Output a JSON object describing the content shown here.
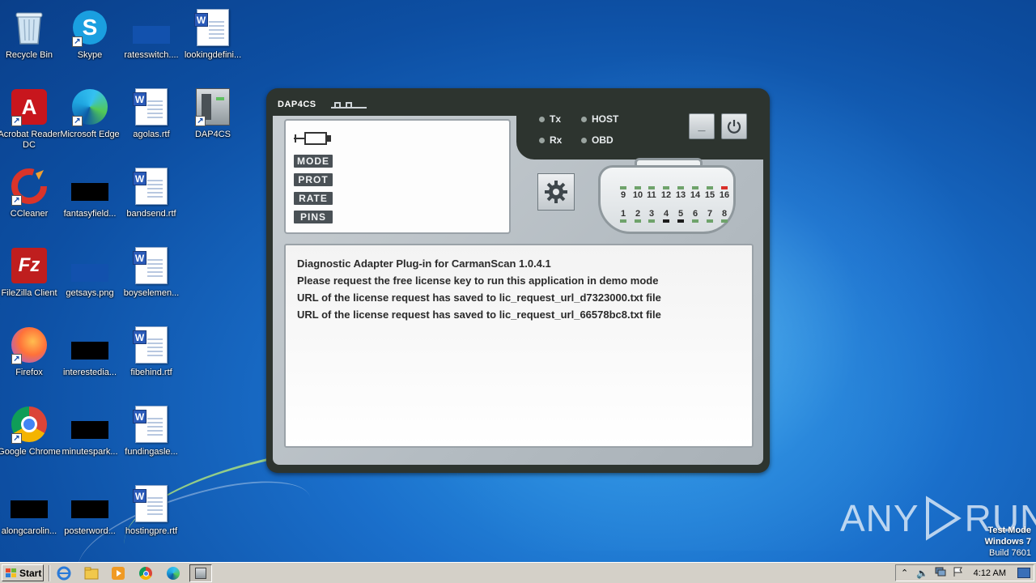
{
  "desktop": {
    "icons": [
      {
        "label": "Recycle Bin"
      },
      {
        "label": "Skype"
      },
      {
        "label": "ratesswitch...."
      },
      {
        "label": "lookingdefini..."
      },
      {
        "label": "Acrobat Reader DC"
      },
      {
        "label": "Microsoft Edge"
      },
      {
        "label": "agolas.rtf"
      },
      {
        "label": "DAP4CS"
      },
      {
        "label": "CCleaner"
      },
      {
        "label": "fantasyfield..."
      },
      {
        "label": "bandsend.rtf"
      },
      {
        "label": "FileZilla Client"
      },
      {
        "label": "getsays.png"
      },
      {
        "label": "boyselemen..."
      },
      {
        "label": "Firefox"
      },
      {
        "label": "interestedia..."
      },
      {
        "label": "fibehind.rtf"
      },
      {
        "label": "Google Chrome"
      },
      {
        "label": "minutespark..."
      },
      {
        "label": "fundingasle..."
      },
      {
        "label": "alongcarolin..."
      },
      {
        "label": "posterword..."
      },
      {
        "label": "hostingpre.rtf"
      }
    ]
  },
  "dap4cs": {
    "title": "DAP4CS",
    "indicators": {
      "tx": "Tx",
      "rx": "Rx",
      "host": "HOST",
      "obd": "OBD"
    },
    "minimize_label": "_",
    "tags": {
      "mode": "MODE",
      "prot": "PROT",
      "rate": "RATE",
      "pins": "PINS"
    },
    "pins_top": [
      "9",
      "10",
      "11",
      "12",
      "13",
      "14",
      "15",
      "16"
    ],
    "pins_bottom": [
      "1",
      "2",
      "3",
      "4",
      "5",
      "6",
      "7",
      "8"
    ],
    "console_lines": [
      "Diagnostic Adapter Plug-in for CarmanScan 1.0.4.1",
      "Please request the free license key to run this application in demo mode",
      "URL of the license request has saved to lic_request_url_d7323000.txt file",
      "URL of the license request has saved to lic_request_url_66578bc8.txt file"
    ]
  },
  "watermark": {
    "text_left": "ANY",
    "text_right": "RUN"
  },
  "test_mode": {
    "line1": "Test Mode",
    "line2": "Windows 7",
    "line3": "Build 7601"
  },
  "taskbar": {
    "start_label": "Start",
    "clock": "4:12 AM"
  },
  "colors": {
    "desktop_blue": "#1a6fcb",
    "window_dark": "#2d342f",
    "panel_gray": "#b4bcc2",
    "pin_red": "#d9302a"
  }
}
